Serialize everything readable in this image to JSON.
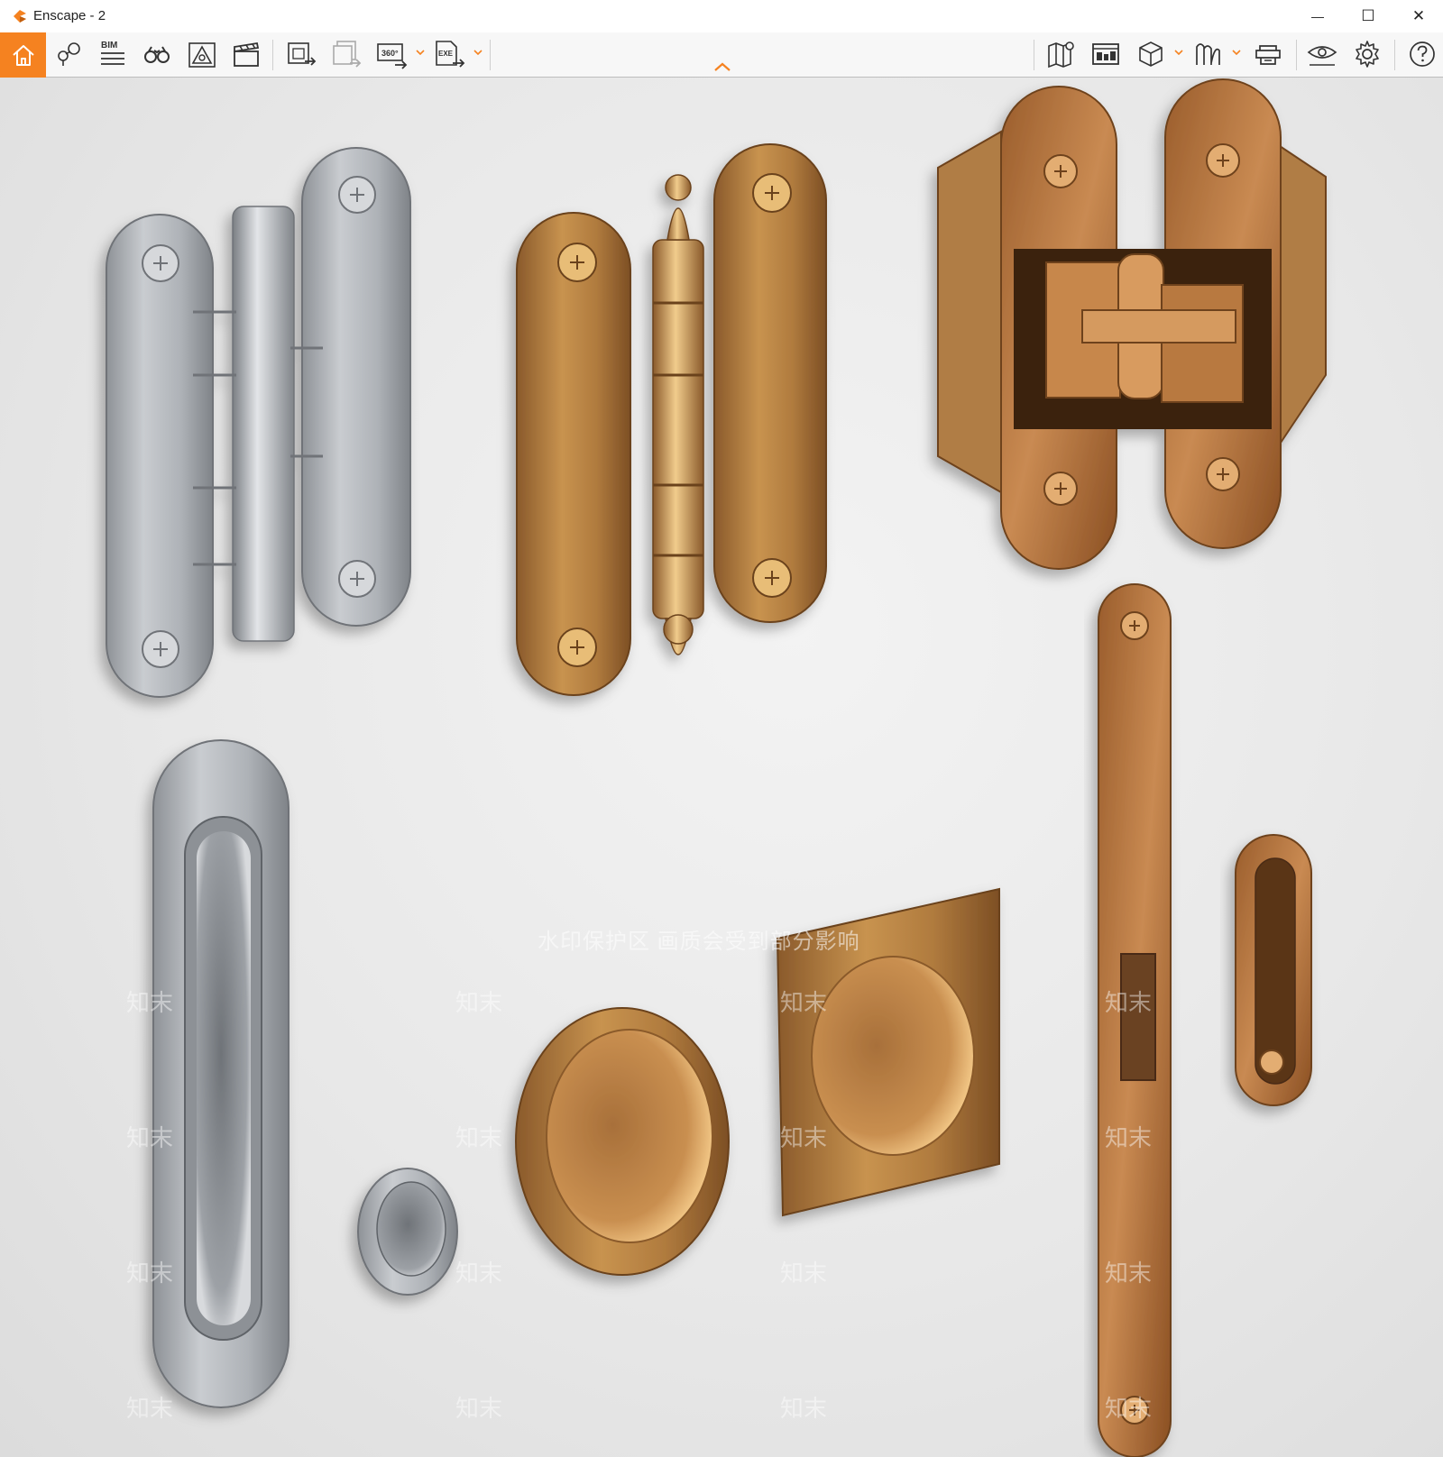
{
  "window": {
    "title": "Enscape - 2",
    "minimize_glyph": "—",
    "maximize_glyph": "☐",
    "close_glyph": "✕"
  },
  "toolbar": {
    "bim_label": "BIM",
    "pano_label": "360°",
    "exe_label": "EXE",
    "accent_color": "#f58220",
    "left_tools": [
      "home-icon",
      "location-pin-icon",
      "bim-icon",
      "binoculars-icon",
      "asset-library-icon",
      "video-clapper-icon",
      "render-image-icon",
      "batch-render-icon",
      "panorama-360-icon",
      "export-exe-icon"
    ],
    "right_tools": [
      "map-icon",
      "views-manager-icon",
      "cube-icon",
      "materials-icon",
      "collaboration-icon",
      "visual-settings-icon",
      "settings-gear-icon",
      "help-icon"
    ]
  },
  "viewport": {
    "watermark_caption": "水印保护区  画质会受到部分影响",
    "watermark_glyph": "知末"
  }
}
